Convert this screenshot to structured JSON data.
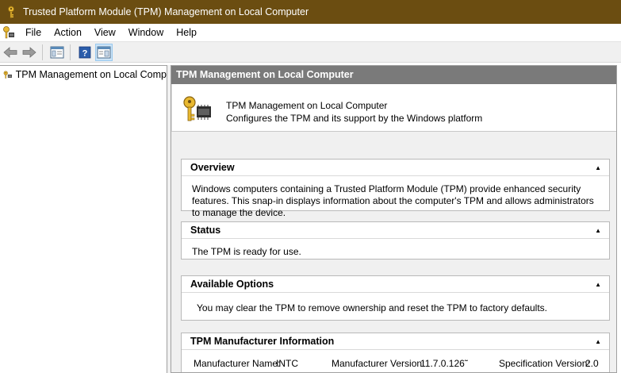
{
  "window": {
    "title": "Trusted Platform Module (TPM) Management on Local Computer"
  },
  "menu": {
    "items": [
      "File",
      "Action",
      "View",
      "Window",
      "Help"
    ]
  },
  "toolbar": {
    "buttons": [
      "back-arrow-icon",
      "forward-arrow-icon",
      "show-hide-console-tree-icon",
      "help-icon",
      "show-action-pane-icon"
    ]
  },
  "tree": {
    "root_label": "TPM Management on Local Comp"
  },
  "content": {
    "header": "TPM Management on Local Computer",
    "intro_title": "TPM Management on Local Computer",
    "intro_desc": "Configures the TPM and its support by the Windows platform"
  },
  "sections": {
    "overview": {
      "title": "Overview",
      "text": "Windows computers containing a Trusted Platform Module (TPM) provide enhanced security features. This snap-in displays information about the computer's TPM and allows administrators to manage the device."
    },
    "status": {
      "title": "Status",
      "text": "The TPM is ready for use."
    },
    "options": {
      "title": "Available Options",
      "text": "You may clear the TPM to remove ownership and reset the TPM to factory defaults."
    },
    "manufacturer": {
      "title": "TPM Manufacturer Information",
      "name_label": "Manufacturer Name:",
      "name_value": "INTC",
      "version_label": "Manufacturer Version:",
      "version_value": "11.7.0.126˜",
      "spec_label": "Specification Version:",
      "spec_value": "2.0"
    }
  },
  "colors": {
    "titlebar": "#6b4d11",
    "content_header": "#7a7a7a",
    "panel_bg": "#f0f0f0"
  }
}
